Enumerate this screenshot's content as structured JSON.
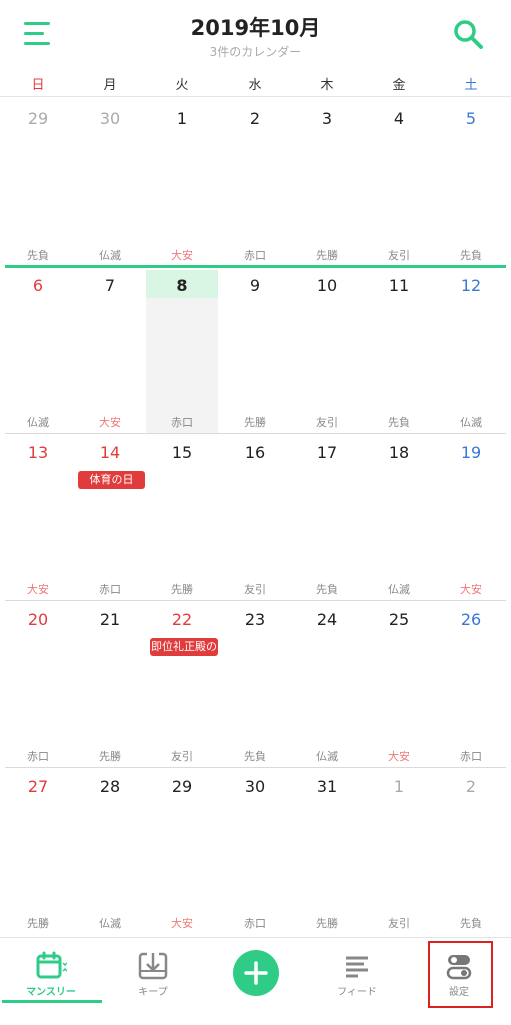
{
  "header": {
    "title": "2019年10月",
    "subtitle": "3件のカレンダー"
  },
  "weekdays": [
    {
      "label": "日",
      "color": "#e03c3c"
    },
    {
      "label": "月",
      "color": "#333333"
    },
    {
      "label": "火",
      "color": "#333333"
    },
    {
      "label": "水",
      "color": "#333333"
    },
    {
      "label": "木",
      "color": "#333333"
    },
    {
      "label": "金",
      "color": "#333333"
    },
    {
      "label": "土",
      "color": "#3a78d4"
    }
  ],
  "colors": {
    "accent": "#2ecc87",
    "sunday": "#e03c3c",
    "saturday": "#3a78d4",
    "muted": "#aaaaaa",
    "taian": "#f07878",
    "event": "#e03c3c"
  },
  "weeks": [
    [
      {
        "day": "29",
        "other": true,
        "rokuyo": "先負"
      },
      {
        "day": "30",
        "other": true,
        "rokuyo": "仏滅"
      },
      {
        "day": "1",
        "rokuyo": "大安"
      },
      {
        "day": "2",
        "rokuyo": "赤口"
      },
      {
        "day": "3",
        "rokuyo": "先勝"
      },
      {
        "day": "4",
        "rokuyo": "友引"
      },
      {
        "day": "5",
        "rokuyo": "先負"
      }
    ],
    [
      {
        "day": "6",
        "rokuyo": "仏滅"
      },
      {
        "day": "7",
        "rokuyo": "大安"
      },
      {
        "day": "8",
        "today": true,
        "rokuyo": "赤口"
      },
      {
        "day": "9",
        "rokuyo": "先勝"
      },
      {
        "day": "10",
        "rokuyo": "友引"
      },
      {
        "day": "11",
        "rokuyo": "先負"
      },
      {
        "day": "12",
        "rokuyo": "仏滅"
      }
    ],
    [
      {
        "day": "13",
        "holiday": true,
        "rokuyo": "大安"
      },
      {
        "day": "14",
        "holiday": true,
        "rokuyo": "赤口",
        "event": "体育の日"
      },
      {
        "day": "15",
        "rokuyo": "先勝"
      },
      {
        "day": "16",
        "rokuyo": "友引"
      },
      {
        "day": "17",
        "rokuyo": "先負"
      },
      {
        "day": "18",
        "rokuyo": "仏滅"
      },
      {
        "day": "19",
        "rokuyo": "大安"
      }
    ],
    [
      {
        "day": "20",
        "holiday": true,
        "rokuyo": "赤口"
      },
      {
        "day": "21",
        "rokuyo": "先勝"
      },
      {
        "day": "22",
        "holiday": true,
        "rokuyo": "友引",
        "event": "即位礼正殿の"
      },
      {
        "day": "23",
        "rokuyo": "先負"
      },
      {
        "day": "24",
        "rokuyo": "仏滅"
      },
      {
        "day": "25",
        "rokuyo": "大安"
      },
      {
        "day": "26",
        "rokuyo": "赤口"
      }
    ],
    [
      {
        "day": "27",
        "holiday": true,
        "rokuyo": "先勝"
      },
      {
        "day": "28",
        "rokuyo": "仏滅"
      },
      {
        "day": "29",
        "rokuyo": "大安"
      },
      {
        "day": "30",
        "rokuyo": "赤口"
      },
      {
        "day": "31",
        "rokuyo": "先勝"
      },
      {
        "day": "1",
        "other": true,
        "rokuyo": "友引"
      },
      {
        "day": "2",
        "other": true,
        "rokuyo": "先負"
      }
    ]
  ],
  "tabbar": {
    "monthly": {
      "label": "マンスリー",
      "icon": "calendar-icon",
      "active": true
    },
    "keep": {
      "label": "キープ",
      "icon": "download-tray-icon"
    },
    "add": {
      "icon": "plus-icon"
    },
    "feed": {
      "label": "フィード",
      "icon": "feed-lines-icon"
    },
    "settings": {
      "label": "設定",
      "icon": "toggle-switches-icon",
      "highlighted": true
    }
  }
}
